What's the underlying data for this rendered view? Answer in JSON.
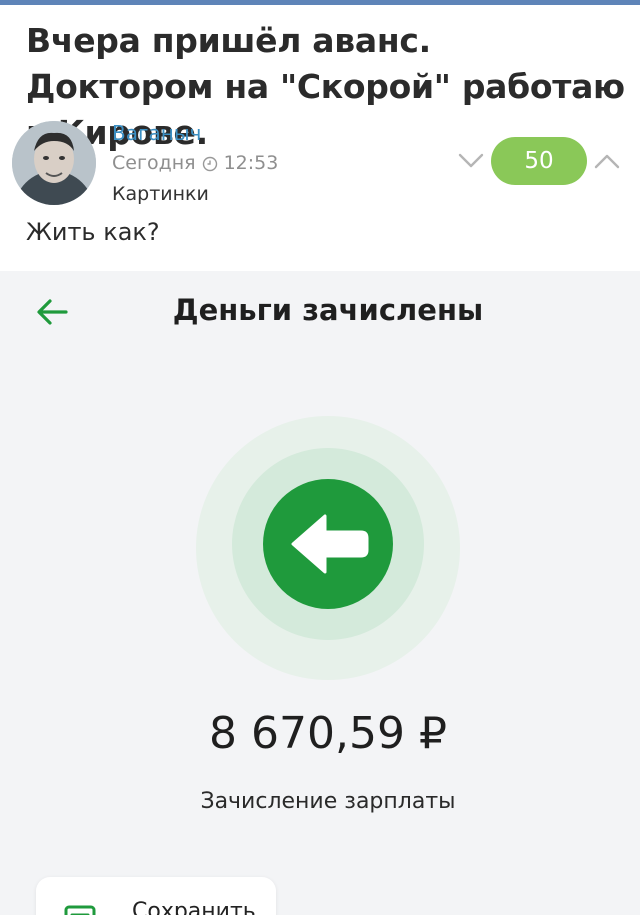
{
  "post": {
    "title": "Вчера пришёл аванс. Доктором на \"Скорой\" работаю в Кирове.",
    "author": "Ваганыч",
    "date": "Сегодня",
    "time": "12:53",
    "category": "Картинки",
    "rating": "50",
    "text": "Жить как?"
  },
  "screenshot": {
    "title": "Деньги зачислены",
    "amount": "8 670,59 ₽",
    "subtitle": "Зачисление зарплаты",
    "save_label": "Сохранить"
  },
  "colors": {
    "accent_blue": "#3b8fc3",
    "rating_green": "#8ac858",
    "bank_green": "#1f9a3c"
  },
  "icons": [
    "avatar",
    "clock-icon",
    "chevron-down-icon",
    "chevron-up-icon",
    "back-arrow-icon",
    "incoming-arrow-icon",
    "save-icon"
  ]
}
